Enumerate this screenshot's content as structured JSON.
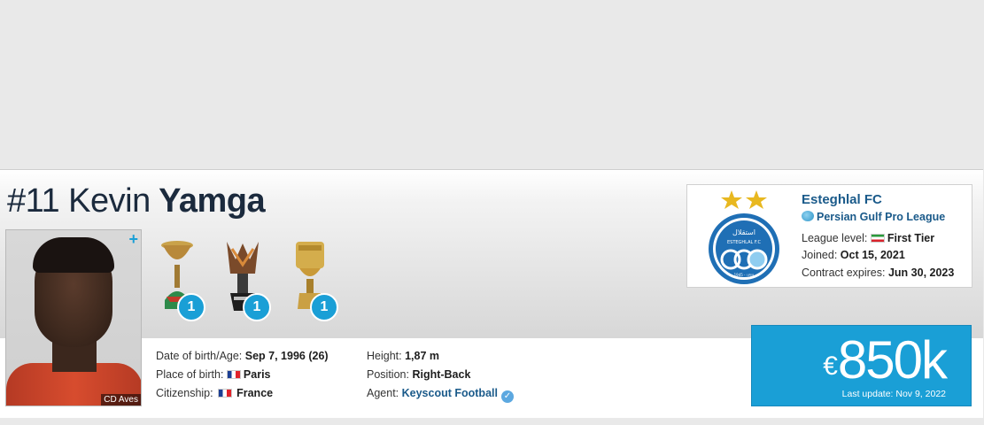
{
  "player": {
    "number": "#11",
    "first_name": "Kevin",
    "last_name": "Yamga",
    "photo_caption": "CD Aves",
    "photo_plus": "+"
  },
  "trophies": [
    {
      "name": "trophy-1",
      "count": "1"
    },
    {
      "name": "trophy-2",
      "count": "1"
    },
    {
      "name": "trophy-3",
      "count": "1"
    }
  ],
  "info_left": {
    "dob_label": "Date of birth/Age:",
    "dob_value": "Sep 7, 1996 (26)",
    "pob_label": "Place of birth:",
    "pob_value": "Paris",
    "citizenship_label": "Citizenship:",
    "citizenship_value": "France"
  },
  "info_right": {
    "height_label": "Height:",
    "height_value": "1,87 m",
    "position_label": "Position:",
    "position_value": "Right-Back",
    "agent_label": "Agent:",
    "agent_value": "Keyscout Football"
  },
  "club": {
    "name": "Esteghlal FC",
    "league": "Persian Gulf Pro League",
    "league_level_label": "League level:",
    "league_level_value": "First Tier",
    "joined_label": "Joined:",
    "joined_value": "Oct 15, 2021",
    "contract_label": "Contract expires:",
    "contract_value": "Jun 30, 2023",
    "logo_text_top": "استقلال",
    "logo_text_fc": "ESTEGHLAL F.C",
    "logo_text_year": "1945 - ۱۳۲۴"
  },
  "market_value": {
    "currency": "€",
    "value": "850k",
    "last_update": "Last update: Nov 9, 2022"
  },
  "colors": {
    "accent": "#1a9fd6",
    "link": "#1a5a8a",
    "title": "#1b2a3d"
  }
}
